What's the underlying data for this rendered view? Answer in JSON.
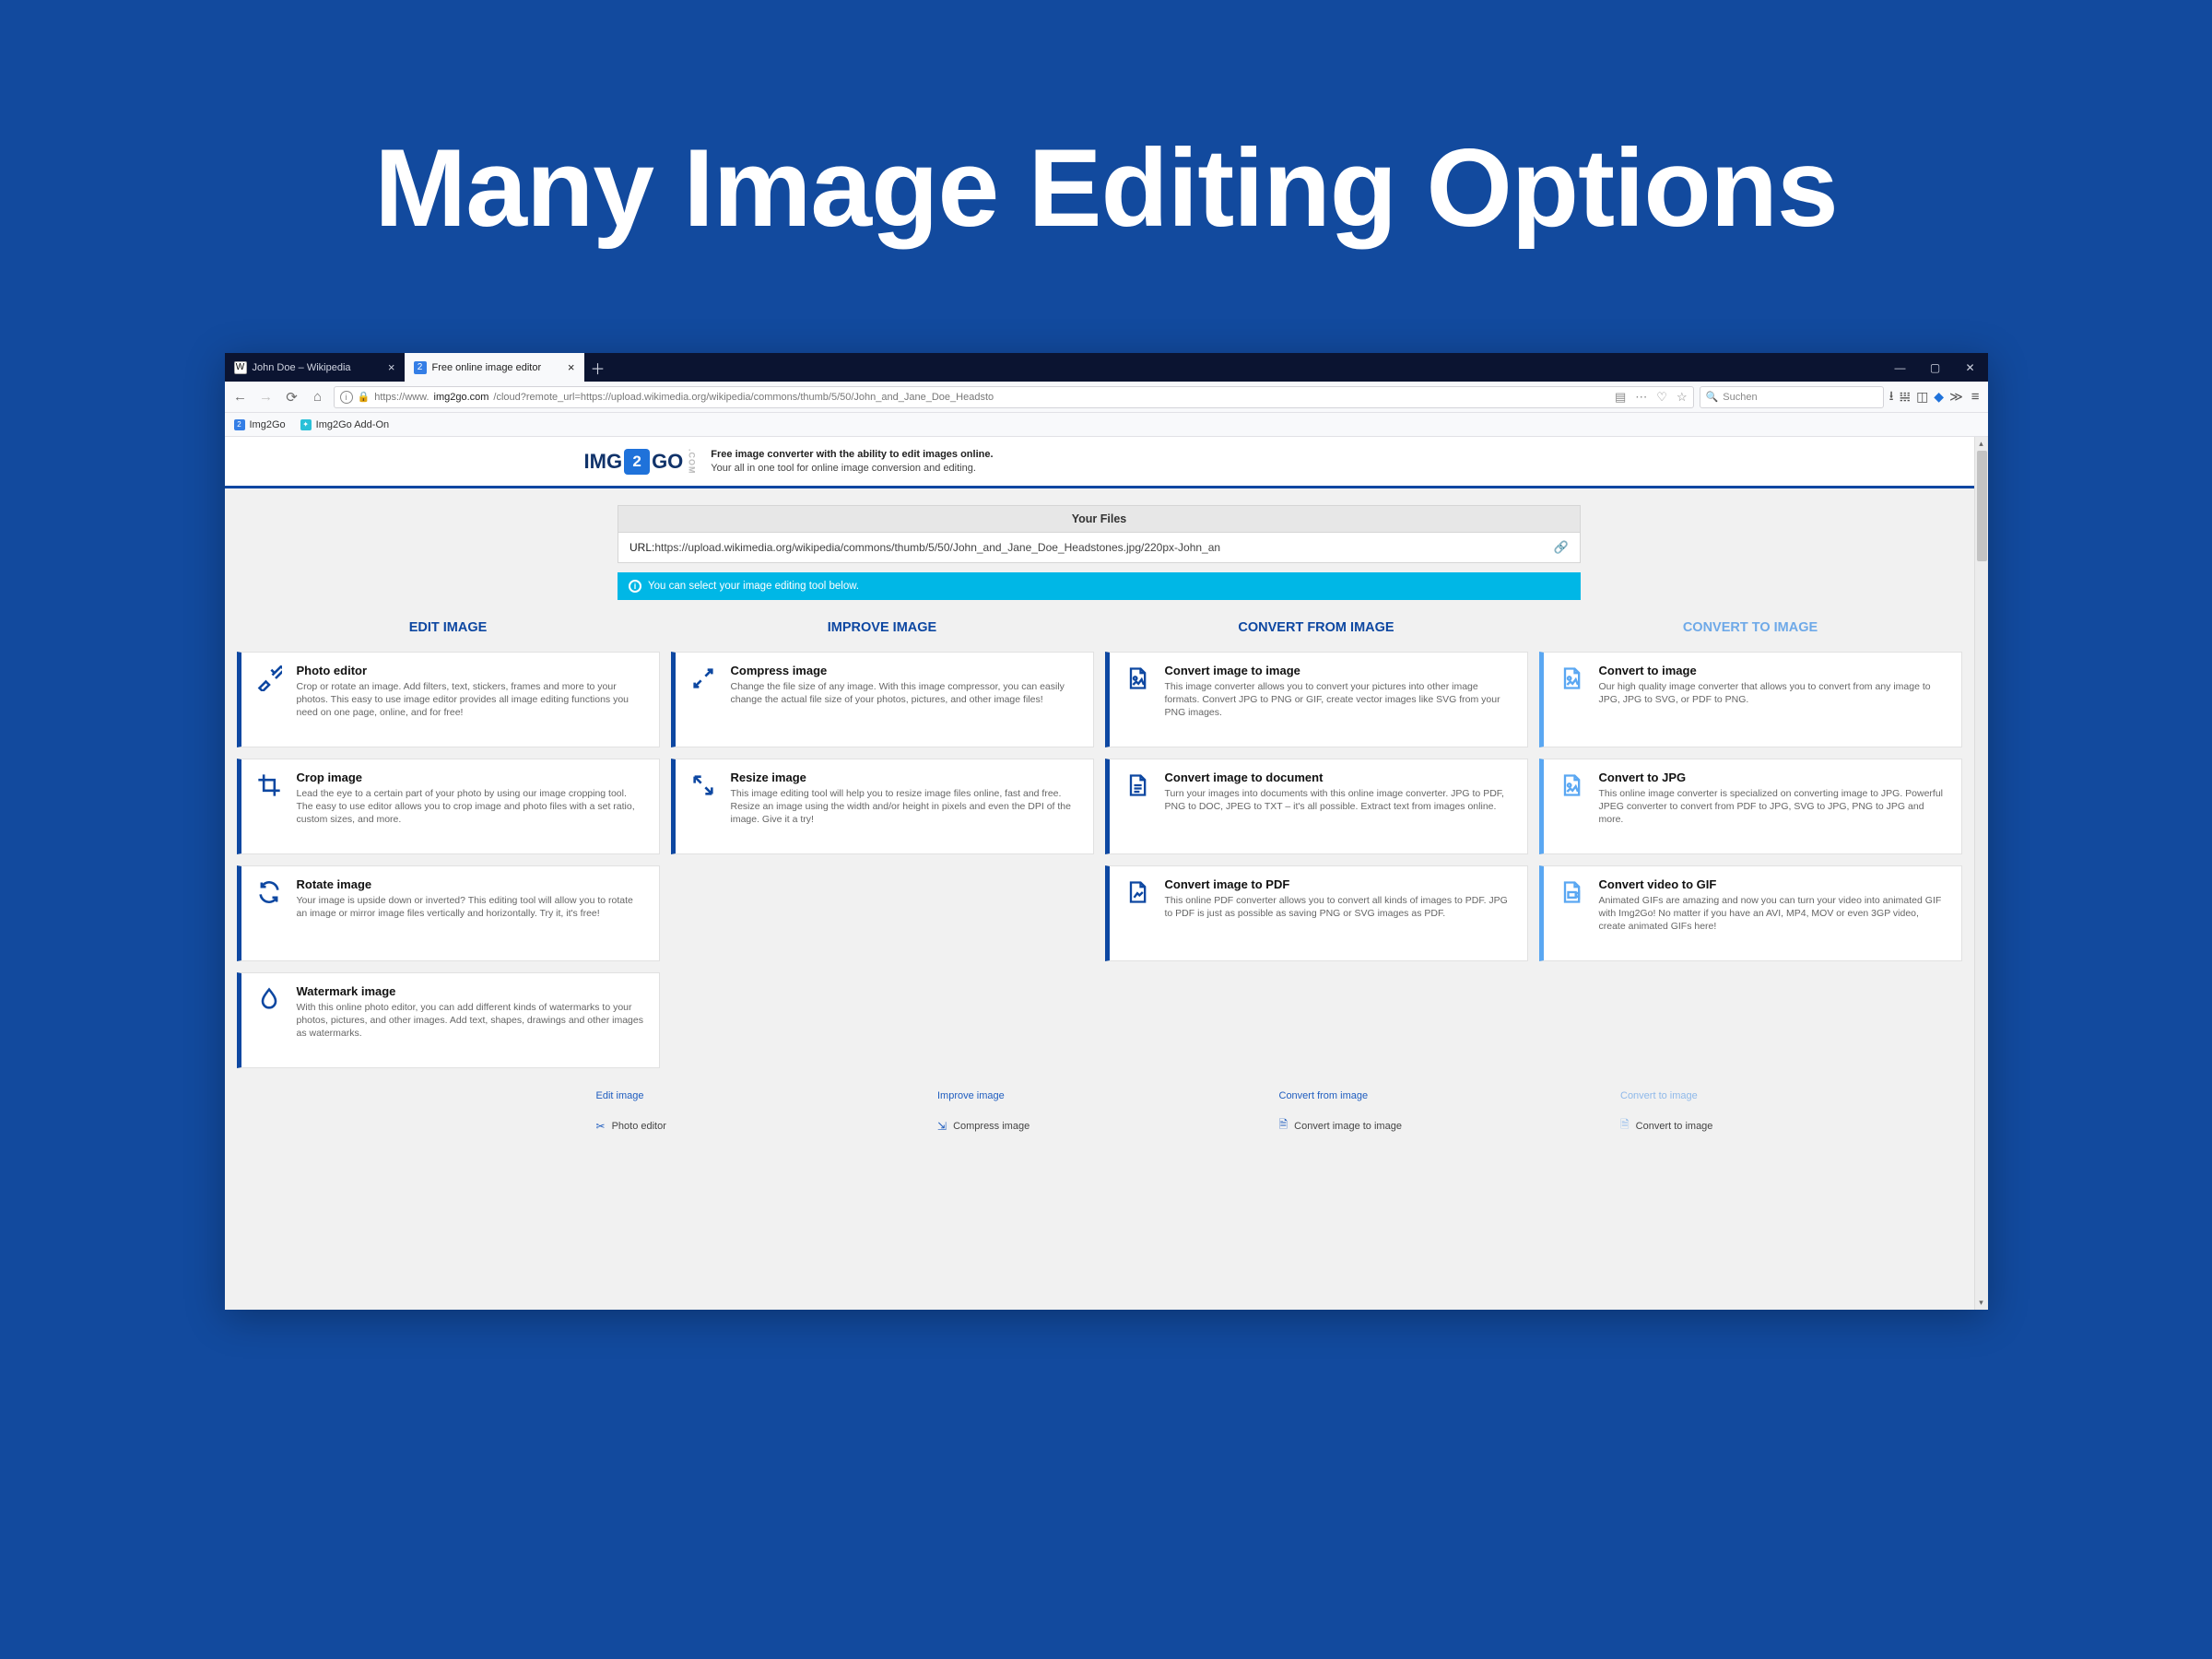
{
  "hero": {
    "title": "Many Image Editing Options"
  },
  "tabs": [
    {
      "favicon": "W",
      "label": "John Doe – Wikipedia",
      "active": false
    },
    {
      "favicon": "2",
      "label": "Free online image editor",
      "active": true
    }
  ],
  "window_buttons": {
    "min": "—",
    "max": "▢",
    "close": "✕"
  },
  "nav": {
    "url_prefix": "https://www.",
    "url_domain": "img2go.com",
    "url_rest": "/cloud?remote_url=https://upload.wikimedia.org/wikipedia/commons/thumb/5/50/John_and_Jane_Doe_Headsto",
    "search_placeholder": "Suchen"
  },
  "bookmarks": [
    {
      "favicon": "2",
      "label": "Img2Go"
    },
    {
      "favicon": "✦",
      "label": "Img2Go Add-On"
    }
  ],
  "site": {
    "logo_left": "IMG",
    "logo_on": "2",
    "logo_right": "GO",
    "logo_suffix": ".COM",
    "tagline_bold": "Free image converter with the ability to edit images online.",
    "tagline_sub": "Your all in one tool for online image conversion and editing."
  },
  "file_panel": {
    "heading": "Your Files",
    "url_label": "URL: ",
    "url_value": "https://upload.wikimedia.org/wikipedia/commons/thumb/5/50/John_and_Jane_Doe_Headstones.jpg/220px-John_an",
    "notice": "You can select your image editing tool below."
  },
  "columns": [
    {
      "title": "EDIT IMAGE",
      "light": false
    },
    {
      "title": "IMPROVE IMAGE",
      "light": false
    },
    {
      "title": "CONVERT FROM IMAGE",
      "light": false
    },
    {
      "title": "CONVERT TO IMAGE",
      "light": true
    }
  ],
  "cards": {
    "c0r0": {
      "title": "Photo editor",
      "desc": "Crop or rotate an image. Add filters, text, stickers, frames and more to your photos. This easy to use image editor provides all image editing functions you need on one page, online, and for free!",
      "icon": "tools"
    },
    "c1r0": {
      "title": "Compress image",
      "desc": "Change the file size of any image. With this image compressor, you can easily change the actual file size of your photos, pictures, and other image files!",
      "icon": "compress"
    },
    "c2r0": {
      "title": "Convert image to image",
      "desc": "This image converter allows you to convert your pictures into other image formats. Convert JPG to PNG or GIF, create vector images like SVG from your PNG images.",
      "icon": "file-img"
    },
    "c3r0": {
      "title": "Convert to image",
      "desc": "Our high quality image converter that allows you to convert from any image to JPG, JPG to SVG, or PDF to PNG.",
      "icon": "file-img"
    },
    "c0r1": {
      "title": "Crop image",
      "desc": "Lead the eye to a certain part of your photo by using our image cropping tool. The easy to use editor allows you to crop image and photo files with a set ratio, custom sizes, and more.",
      "icon": "crop"
    },
    "c1r1": {
      "title": "Resize image",
      "desc": "This image editing tool will help you to resize image files online, fast and free. Resize an image using the width and/or height in pixels and even the DPI of the image. Give it a try!",
      "icon": "resize"
    },
    "c2r1": {
      "title": "Convert image to document",
      "desc": "Turn your images into documents with this online image converter. JPG to PDF, PNG to DOC, JPEG to TXT – it's all possible. Extract text from images online.",
      "icon": "file-doc"
    },
    "c3r1": {
      "title": "Convert to JPG",
      "desc": "This online image converter is specialized on converting image to JPG. Powerful JPEG converter to convert from PDF to JPG, SVG to JPG, PNG to JPG and more.",
      "icon": "file-img"
    },
    "c0r2": {
      "title": "Rotate image",
      "desc": "Your image is upside down or inverted? This editing tool will allow you to rotate an image or mirror image files vertically and horizontally. Try it, it's free!",
      "icon": "rotate"
    },
    "c2r2": {
      "title": "Convert image to PDF",
      "desc": "This online PDF converter allows you to convert all kinds of images to PDF. JPG to PDF is just as possible as saving PNG or SVG images as PDF.",
      "icon": "file-pdf"
    },
    "c3r2": {
      "title": "Convert video to GIF",
      "desc": "Animated GIFs are amazing and now you can turn your video into animated GIF with Img2Go! No matter if you have an AVI, MP4, MOV or even 3GP video, create animated GIFs here!",
      "icon": "file-vid"
    },
    "c0r3": {
      "title": "Watermark image",
      "desc": "With this online photo editor, you can add different kinds of watermarks to your photos, pictures, and other images. Add text, shapes, drawings and other images as watermarks.",
      "icon": "drop"
    }
  },
  "footer": {
    "heads": [
      "Edit image",
      "Improve image",
      "Convert from image",
      "Convert to image"
    ],
    "links": [
      "Photo editor",
      "Compress image",
      "Convert image to image",
      "Convert to image"
    ]
  }
}
